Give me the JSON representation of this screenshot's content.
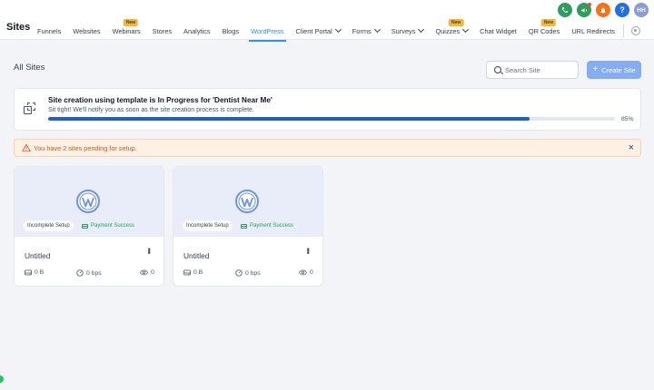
{
  "app": {
    "brand": "Sites"
  },
  "nav": {
    "items": [
      {
        "label": "Funnels",
        "badge": "",
        "dropdown": false,
        "active": false
      },
      {
        "label": "Websites",
        "badge": "",
        "dropdown": false,
        "active": false
      },
      {
        "label": "Webinars",
        "badge": "New",
        "dropdown": false,
        "active": false
      },
      {
        "label": "Stores",
        "badge": "",
        "dropdown": false,
        "active": false
      },
      {
        "label": "Analytics",
        "badge": "",
        "dropdown": false,
        "active": false
      },
      {
        "label": "Blogs",
        "badge": "",
        "dropdown": false,
        "active": false
      },
      {
        "label": "WordPress",
        "badge": "",
        "dropdown": false,
        "active": true
      },
      {
        "label": "Client Portal",
        "badge": "",
        "dropdown": true,
        "active": false
      },
      {
        "label": "Forms",
        "badge": "",
        "dropdown": true,
        "active": false
      },
      {
        "label": "Surveys",
        "badge": "",
        "dropdown": true,
        "active": false
      },
      {
        "label": "Quizzes",
        "badge": "New",
        "dropdown": true,
        "active": false
      },
      {
        "label": "Chat Widget",
        "badge": "",
        "dropdown": false,
        "active": false
      },
      {
        "label": "QR Codes",
        "badge": "New",
        "dropdown": false,
        "active": false
      },
      {
        "label": "URL Redirects",
        "badge": "",
        "dropdown": false,
        "active": false
      }
    ]
  },
  "header_icons": {
    "avatar_initials": "HH",
    "help_glyph": "?",
    "icons": [
      "phone-icon",
      "megaphone-icon",
      "bell-icon",
      "help-icon"
    ]
  },
  "page": {
    "title": "All Sites",
    "search_placeholder": "Search Site",
    "create_label": "Create Site"
  },
  "progress": {
    "title": "Site creation using template is In Progress for 'Dentist Near Me'",
    "subtitle": "Sit tight! We'll notify you as soon as the site creation process is complete.",
    "percent": 85,
    "percent_label": "85%"
  },
  "alert": {
    "text": "You have 2 sites pending for setup.",
    "close_glyph": "×"
  },
  "sites": [
    {
      "name": "Untitled",
      "status": "Incomplete Setup",
      "payment": "Payment Success",
      "storage": "0 B",
      "bandwidth": "0 bps",
      "views": "0"
    },
    {
      "name": "Untitled",
      "status": "Incomplete Setup",
      "payment": "Payment Success",
      "storage": "0 B",
      "bandwidth": "0 bps",
      "views": "0"
    }
  ],
  "colors": {
    "accent": "#2e90fa",
    "progress": "#1f5fd6",
    "warning": "#d9581c",
    "success": "#22a05a"
  }
}
